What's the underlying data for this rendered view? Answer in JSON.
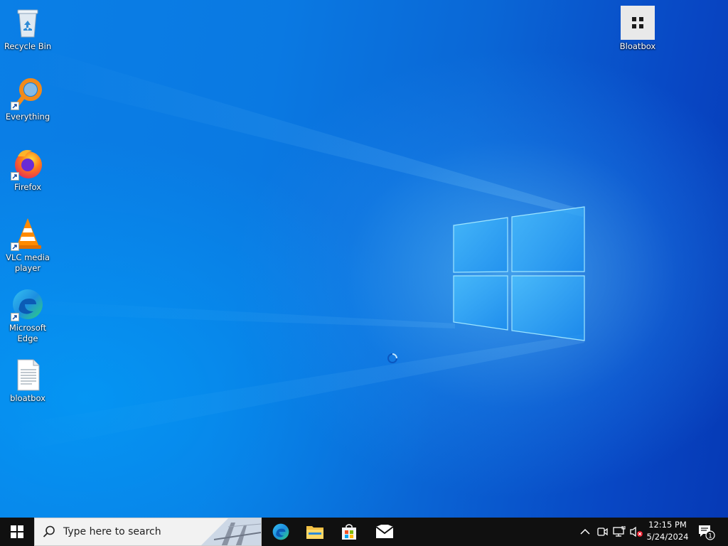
{
  "desktop": {
    "icons": [
      {
        "label": "Recycle Bin",
        "icon": "recycle-bin-icon"
      },
      {
        "label": "Everything",
        "icon": "everything-search-icon"
      },
      {
        "label": "Firefox",
        "icon": "firefox-icon"
      },
      {
        "label": "VLC media player",
        "icon": "vlc-icon"
      },
      {
        "label": "Microsoft Edge",
        "icon": "edge-icon"
      },
      {
        "label": "bloatbox",
        "icon": "text-file-icon"
      },
      {
        "label": "Bloatbox",
        "icon": "bloatbox-app-icon"
      }
    ]
  },
  "taskbar": {
    "search_placeholder": "Type here to search",
    "pinned": [
      {
        "name": "Microsoft Edge",
        "icon": "edge-icon"
      },
      {
        "name": "File Explorer",
        "icon": "folder-icon"
      },
      {
        "name": "Microsoft Store",
        "icon": "store-icon"
      },
      {
        "name": "Mail",
        "icon": "mail-icon"
      }
    ],
    "tray": {
      "time": "12:15 PM",
      "date": "5/24/2024",
      "notification_count": "1"
    }
  },
  "colors": {
    "taskbar_bg": "#101010",
    "wallpaper_accent": "#0a79e2"
  }
}
